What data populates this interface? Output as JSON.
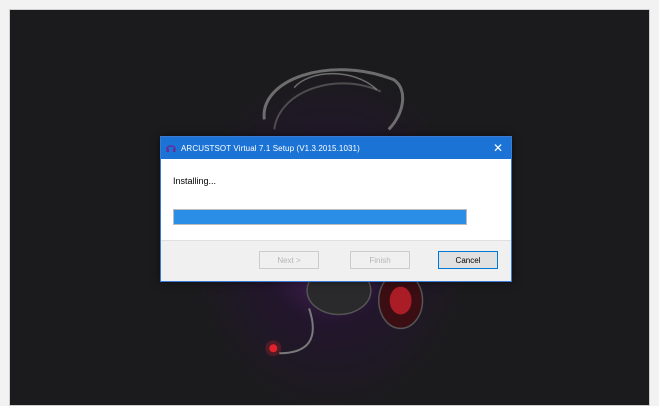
{
  "dialog": {
    "title": "ARCUSTSOT Virtual 7.1 Setup (V1.3.2015.1031)",
    "status_text": "Installing...",
    "progress_fraction": 1.0,
    "close_symbol": "✕",
    "buttons": {
      "next_label": "Next >",
      "finish_label": "Finish",
      "cancel_label": "Cancel"
    }
  },
  "colors": {
    "titlebar": "#1c73d6",
    "progress": "#2a8de6",
    "background": "#1b1b1d",
    "accent_glow": "#5f2878",
    "led_red": "#e0242a"
  },
  "icons": {
    "app": "headset-app-icon",
    "close": "close-icon"
  }
}
